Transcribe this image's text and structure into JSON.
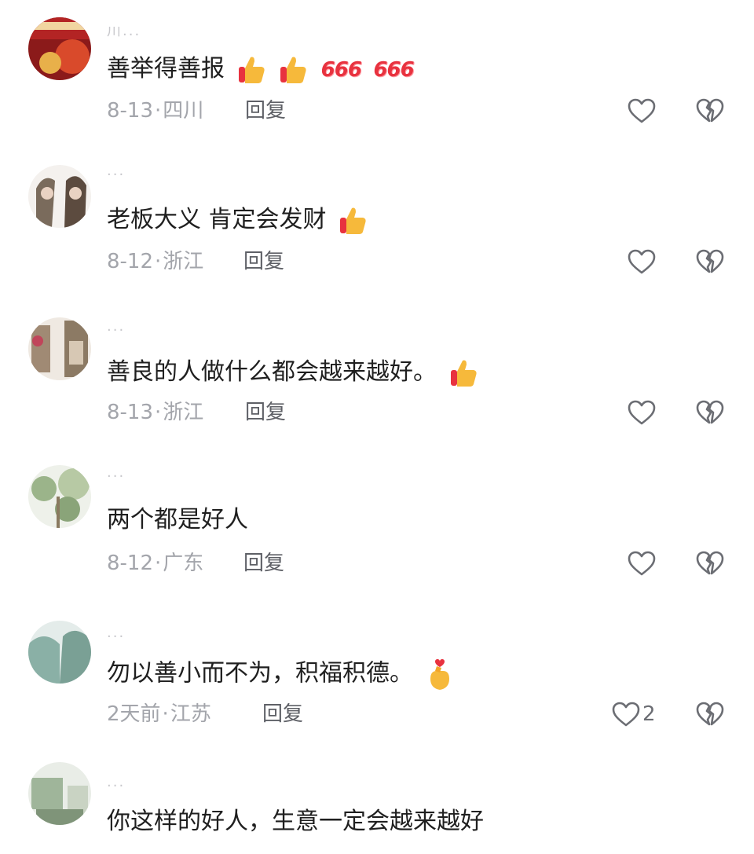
{
  "comments": [
    {
      "username": "川...",
      "text": "善举得善报",
      "emojis": [
        "thumbs-up",
        "thumbs-up",
        "666",
        "666"
      ],
      "date": "8-13",
      "location": "四川",
      "reply": "回复",
      "likes": ""
    },
    {
      "username": "...",
      "text": "老板大义 肯定会发财",
      "emojis": [
        "thumbs-up"
      ],
      "date": "8-12",
      "location": "浙江",
      "reply": "回复",
      "likes": ""
    },
    {
      "username": "...",
      "text": "善良的人做什么都会越来越好。",
      "emojis": [
        "thumbs-up"
      ],
      "date": "8-13",
      "location": "浙江",
      "reply": "回复",
      "likes": ""
    },
    {
      "username": "...",
      "text": "两个都是好人",
      "emojis": [],
      "date": "8-12",
      "location": "广东",
      "reply": "回复",
      "likes": ""
    },
    {
      "username": "...",
      "text": "勿以善小而不为，积福积德。",
      "emojis": [
        "finger-heart"
      ],
      "date": "2天前",
      "location": "江苏",
      "reply": "回复",
      "likes": "2"
    },
    {
      "username": "...",
      "text": "你这样的好人，生意一定会越来越好",
      "emojis": [],
      "date": "",
      "location": "",
      "reply": "",
      "likes": ""
    }
  ],
  "badges": {
    "six": "666"
  },
  "meta_separator": "·",
  "colors": {
    "text": "#1f1f1f",
    "meta": "#a3a5ab",
    "reply": "#5e6066",
    "icon": "#6b6d73",
    "thumb": "#f6b93b",
    "six": "#e8323f"
  }
}
